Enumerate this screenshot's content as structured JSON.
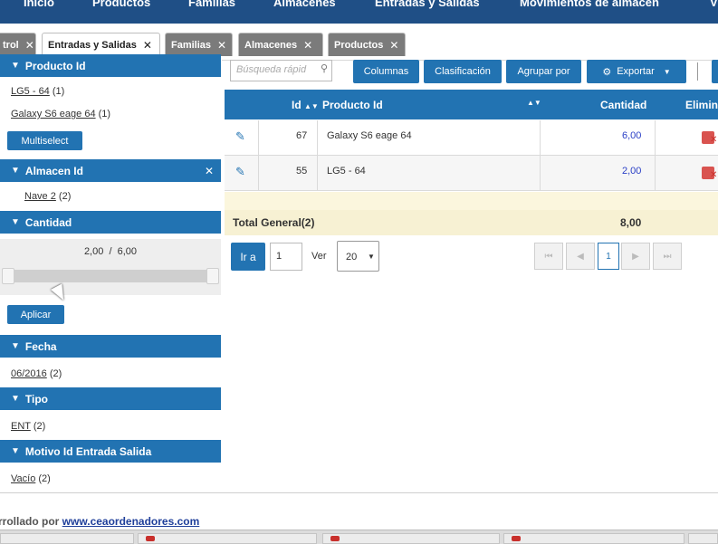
{
  "topnav": {
    "items": [
      "Inicio",
      "Productos",
      "Familias",
      "Almacenes",
      "Entradas y Salidas",
      "Movimientos de almacén",
      "V"
    ]
  },
  "tabs": [
    {
      "label": "trol",
      "active": false
    },
    {
      "label": "Entradas y Salidas",
      "active": true
    },
    {
      "label": "Familias",
      "active": false
    },
    {
      "label": "Almacenes",
      "active": false
    },
    {
      "label": "Productos",
      "active": false
    }
  ],
  "sidebar": {
    "producto": {
      "title": "Producto Id",
      "items": [
        {
          "link": "LG5 - 64",
          "count": "(1)"
        },
        {
          "link": "Galaxy S6 eage 64",
          "count": "(1)"
        }
      ],
      "multiselect": "Multiselect"
    },
    "almacen": {
      "title": "Almacen Id",
      "items": [
        {
          "link": "Nave 2",
          "count": "(2)"
        }
      ]
    },
    "cantidad": {
      "title": "Cantidad",
      "range_text": "2,00  /  6,00",
      "apply": "Aplicar"
    },
    "fecha": {
      "title": "Fecha",
      "items": [
        {
          "link": "06/2016",
          "count": "(2)"
        }
      ]
    },
    "tipo": {
      "title": "Tipo",
      "items": [
        {
          "link": "ENT",
          "count": "(2)"
        }
      ]
    },
    "motivo": {
      "title": "Motivo Id Entrada Salida",
      "items": [
        {
          "link": "Vacío",
          "count": "(2)"
        }
      ]
    }
  },
  "toolbar": {
    "search_placeholder": "Búsqueda rápid",
    "columnas": "Columnas",
    "clasificacion": "Clasificación",
    "agrupar": "Agrupar por",
    "exportar": "Exportar"
  },
  "grid": {
    "headers": {
      "id": "Id",
      "producto": "Producto Id",
      "cantidad": "Cantidad",
      "eliminar": "Elimin"
    },
    "rows": [
      {
        "id": "67",
        "producto": "Galaxy S6 eage 64",
        "cantidad": "6,00"
      },
      {
        "id": "55",
        "producto": "LG5 - 64",
        "cantidad": "2,00"
      }
    ],
    "total_label": "Total General(2)",
    "total_value": "8,00"
  },
  "pager": {
    "goto": "Ir a",
    "page_input": "1",
    "ver": "Ver",
    "page_size": "20",
    "current_page": "1"
  },
  "footer": {
    "prefix": "rrollado por ",
    "link": "www.ceaordenadores.com"
  },
  "colors": {
    "nav": "#1f4f86",
    "accent": "#2273b2",
    "tab_inactive": "#7b7b7b",
    "total_bg": "#f7f1d3",
    "link_blue": "#2a3fc6"
  }
}
